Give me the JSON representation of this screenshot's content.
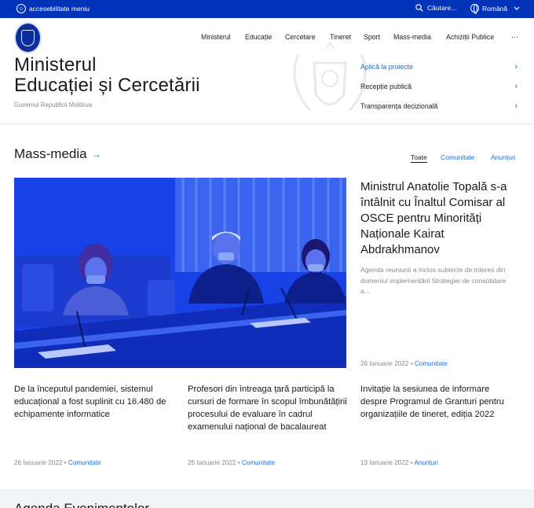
{
  "topbar": {
    "accessibility_label": "accesebilitate meniu",
    "search_label": "Căutare...",
    "language": "Română"
  },
  "nav": {
    "items": [
      "Ministerul",
      "Educație",
      "Cercetare",
      "Tineret",
      "Sport",
      "Mass-media",
      "Achiziții Publice"
    ],
    "more": "···"
  },
  "header": {
    "title_line1": "Ministerul",
    "title_line2": "Educației și Cercetării",
    "subtitle": "Guvernul Republicii Moldova"
  },
  "quick_links": [
    {
      "label": "Aplică la proiecte",
      "active": true
    },
    {
      "label": "Recepție publică",
      "active": false
    },
    {
      "label": "Transparența decizională",
      "active": false
    }
  ],
  "media": {
    "title": "Mass-media",
    "filters": {
      "all": "Toate",
      "communiques": "Comunitate",
      "announcements": "Anunțuri"
    }
  },
  "featured": {
    "title": "Ministrul Anatolie Topală s-a întâlnit cu Înaltul Comisar al OSCE pentru Minorități Naționale Kairat Abdrakhmanov",
    "description": "Agenda reuniunii a inclus subiecte de interes din domeniul implementării Strategiei de consolidare a...",
    "date": "26 Ianuarie 2022",
    "category": "Comunitate"
  },
  "cards": [
    {
      "title": "De la începutul pandemiei, sistemul educațional a fost suplinit cu 16.480 de echipamente informatice",
      "date": "26 Ianuarie 2022",
      "category": "Comunitate"
    },
    {
      "title": "Profesori din întreaga țară participă la cursuri de formare în scopul îmbunătățirii procesului de evaluare în cadrul examenului național de bacalaureat",
      "date": "25 Ianuarie 2022",
      "category": "Comunitate"
    },
    {
      "title": "Invitație la sesiunea de informare despre Programul de Granturi pentru organizațiile de tineret, ediția 2022",
      "date": "13 Ianuarie 2022",
      "category": "Anunțuri"
    }
  ],
  "bottom": {
    "title": "Agenda Evenimentelor"
  },
  "colors": {
    "topbar": "#0033b8",
    "accent": "#1a6fd6",
    "hero_tint": "#1740e0"
  }
}
